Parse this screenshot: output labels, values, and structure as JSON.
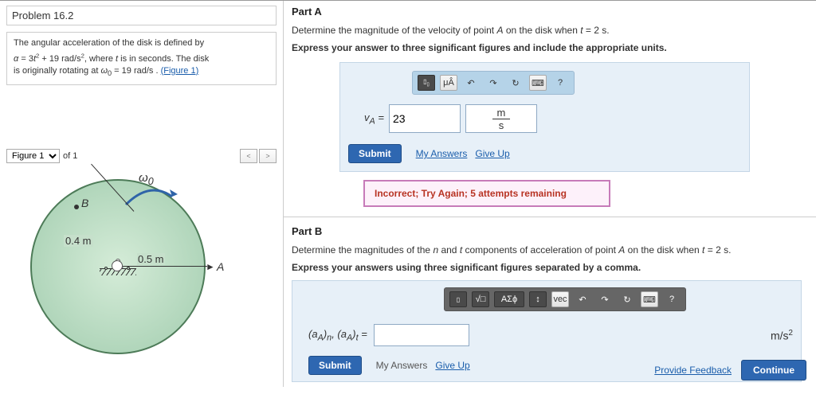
{
  "problem": {
    "title": "Problem 16.2",
    "desc_html": "The angular acceleration of the disk is defined by α = 3t² + 19 rad/s², where t is in seconds. The disk is originally rotating at ω₀ = 19 rad/s .",
    "figure_link": "(Figure 1)"
  },
  "figure": {
    "selector_label": "Figure 1",
    "of_label": "of 1",
    "omega_label": "ω₀",
    "point_b": "B",
    "radius_label": "0.4 m",
    "roller_label": "0.5 m",
    "point_a": "A"
  },
  "partA": {
    "heading": "Part A",
    "question": "Determine the magnitude of the velocity of point A on the disk when t = 2 s.",
    "instruction": "Express your answer to three significant figures and include the appropriate units.",
    "toolbar": {
      "t1": "■",
      "t2": "μÂ",
      "undo": "↶",
      "redo": "↷",
      "reset": "↻",
      "kbd": "⌨",
      "help": "?"
    },
    "var_label": "v_A =",
    "value": "23",
    "unit_num": "m",
    "unit_den": "s",
    "submit": "Submit",
    "my_answers": "My Answers",
    "give_up": "Give Up",
    "feedback": "Incorrect; Try Again; 5 attempts remaining"
  },
  "partB": {
    "heading": "Part B",
    "question": "Determine the magnitudes of the n and t components of acceleration of point A on the disk when t = 2 s.",
    "instruction": "Express your answers using three significant figures separated by a comma.",
    "toolbar": {
      "t1": "■",
      "t2": "√□",
      "t3": "ΑΣϕ",
      "t4": "↕",
      "vec": "vec",
      "undo": "↶",
      "redo": "↷",
      "reset": "↻",
      "kbd": "⌨",
      "help": "?"
    },
    "var_label": "(a_A)_n, (a_A)_t =",
    "value": "",
    "unit": "m/s²",
    "submit": "Submit",
    "my_answers": "My Answers",
    "give_up": "Give Up"
  },
  "footer": {
    "provide_feedback": "Provide Feedback",
    "continue": "Continue"
  }
}
